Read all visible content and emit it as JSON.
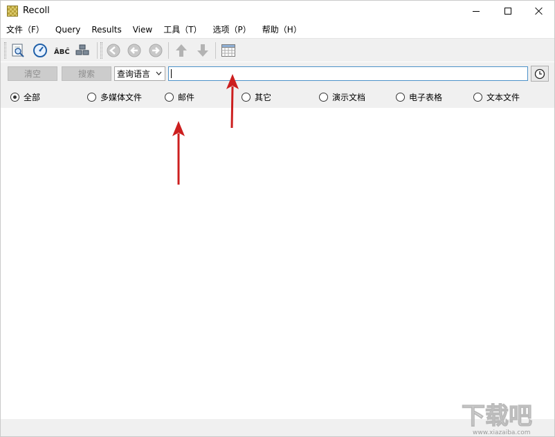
{
  "window": {
    "title": "Recoll"
  },
  "menu": {
    "items": [
      "文件（F）",
      "Query",
      "Results",
      "View",
      "工具（T）",
      "选项（P）",
      "帮助（H）"
    ]
  },
  "toolbar": {
    "icons": [
      "search-preview-icon",
      "index-update-icon",
      "spelling-icon",
      "query-fragments-icon",
      "back-icon",
      "prev-icon",
      "next-icon",
      "up-icon",
      "down-icon",
      "table-view-icon"
    ]
  },
  "search": {
    "clear_label": "清空",
    "search_label": "搜索",
    "mode_selected": "查询语言",
    "query_value": "",
    "history_icon": "clock-icon"
  },
  "filters": {
    "items": [
      "全部",
      "多媒体文件",
      "邮件",
      "其它",
      "演示文档",
      "电子表格",
      "文本文件"
    ],
    "selected_index": 0
  },
  "colors": {
    "annotation_arrow": "#cc1f1f",
    "input_border": "#4a90c8",
    "panel_bg": "#f0f0f0"
  },
  "watermark": {
    "text": "下载吧",
    "url": "www.xiazaiba.com"
  }
}
